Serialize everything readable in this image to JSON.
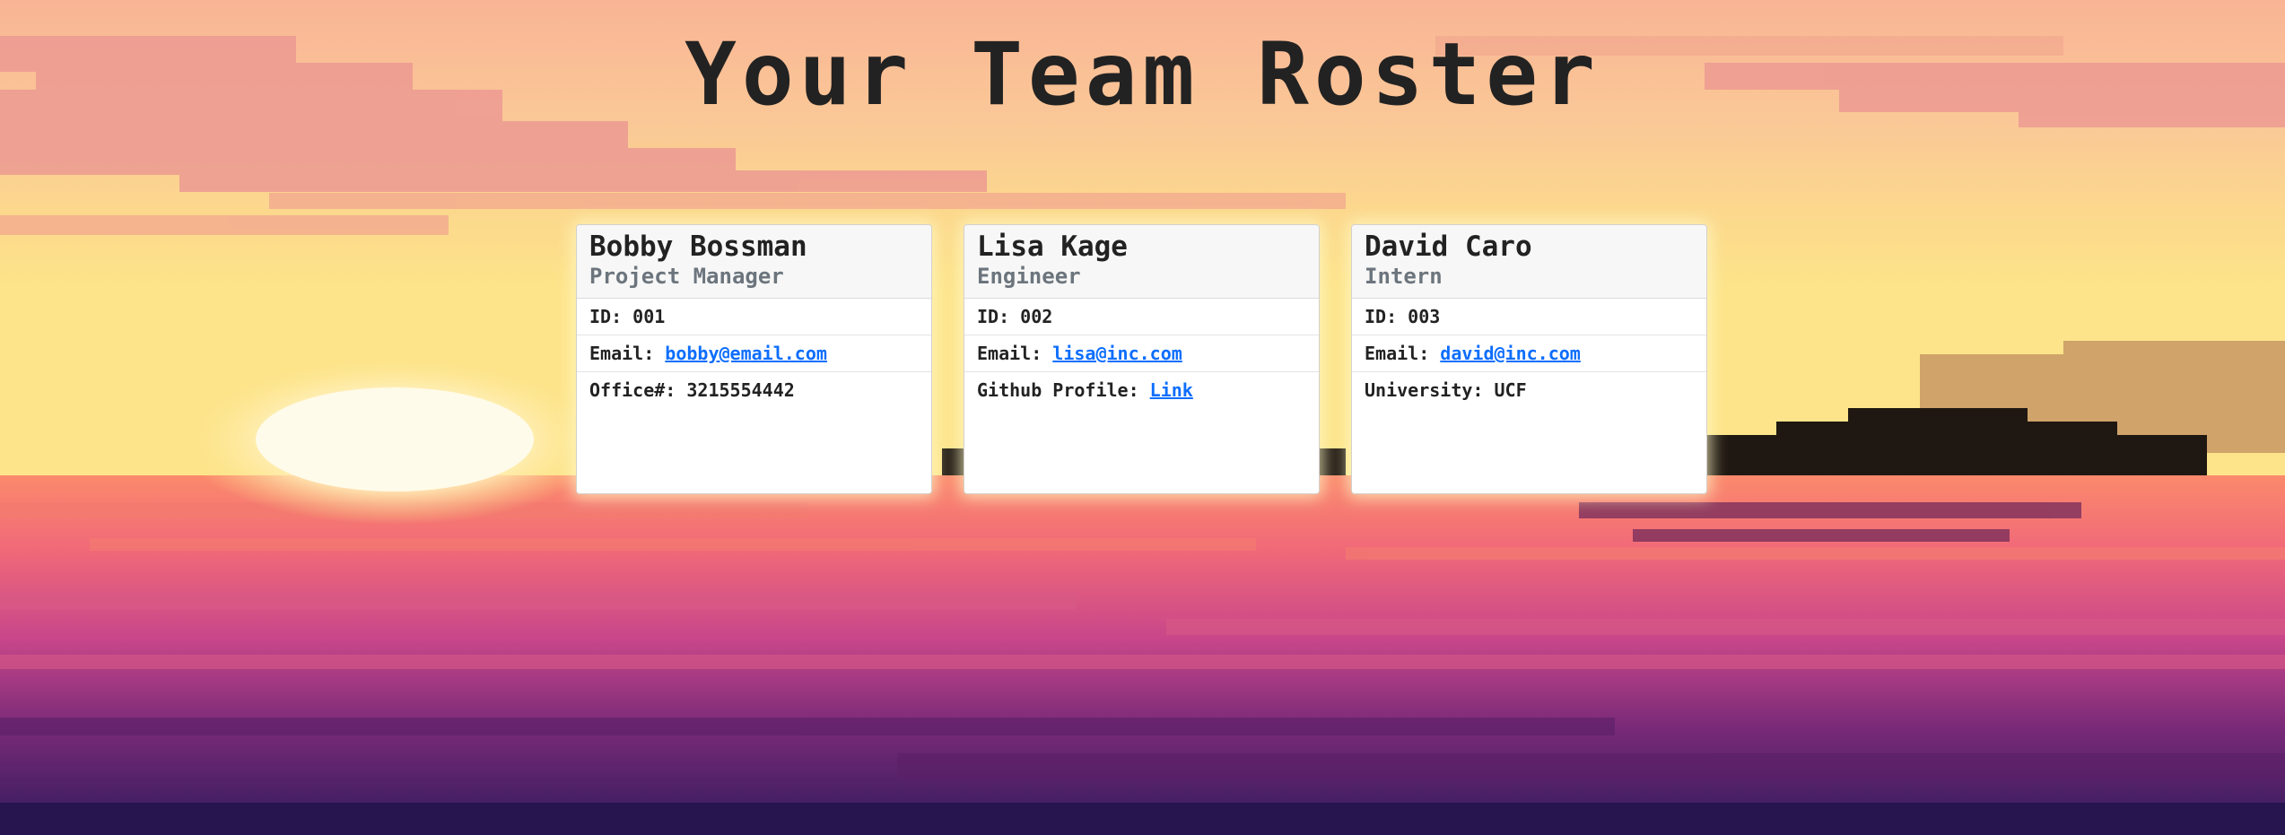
{
  "header": {
    "title": "Your Team Roster"
  },
  "colors": {
    "title": "#222222",
    "link": "#0d6efd",
    "role": "#6c757d",
    "sky_top": "#f8b896",
    "sea": "#a8347a",
    "sun": "#fff6d8"
  },
  "team": [
    {
      "name": "Bobby Bossman",
      "role": "Project Manager",
      "id_label": "ID:",
      "id": "001",
      "email_label": "Email:",
      "email": "bobby@email.com",
      "extra_label": "Office#:",
      "extra_value": "3215554442"
    },
    {
      "name": "Lisa Kage",
      "role": "Engineer",
      "id_label": "ID:",
      "id": "002",
      "email_label": "Email:",
      "email": "lisa@inc.com",
      "extra_label": "Github Profile:",
      "extra_value": "Link"
    },
    {
      "name": "David Caro",
      "role": "Intern",
      "id_label": "ID:",
      "id": "003",
      "email_label": "Email:",
      "email": "david@inc.com",
      "extra_label": "University:",
      "extra_value": "UCF"
    }
  ]
}
